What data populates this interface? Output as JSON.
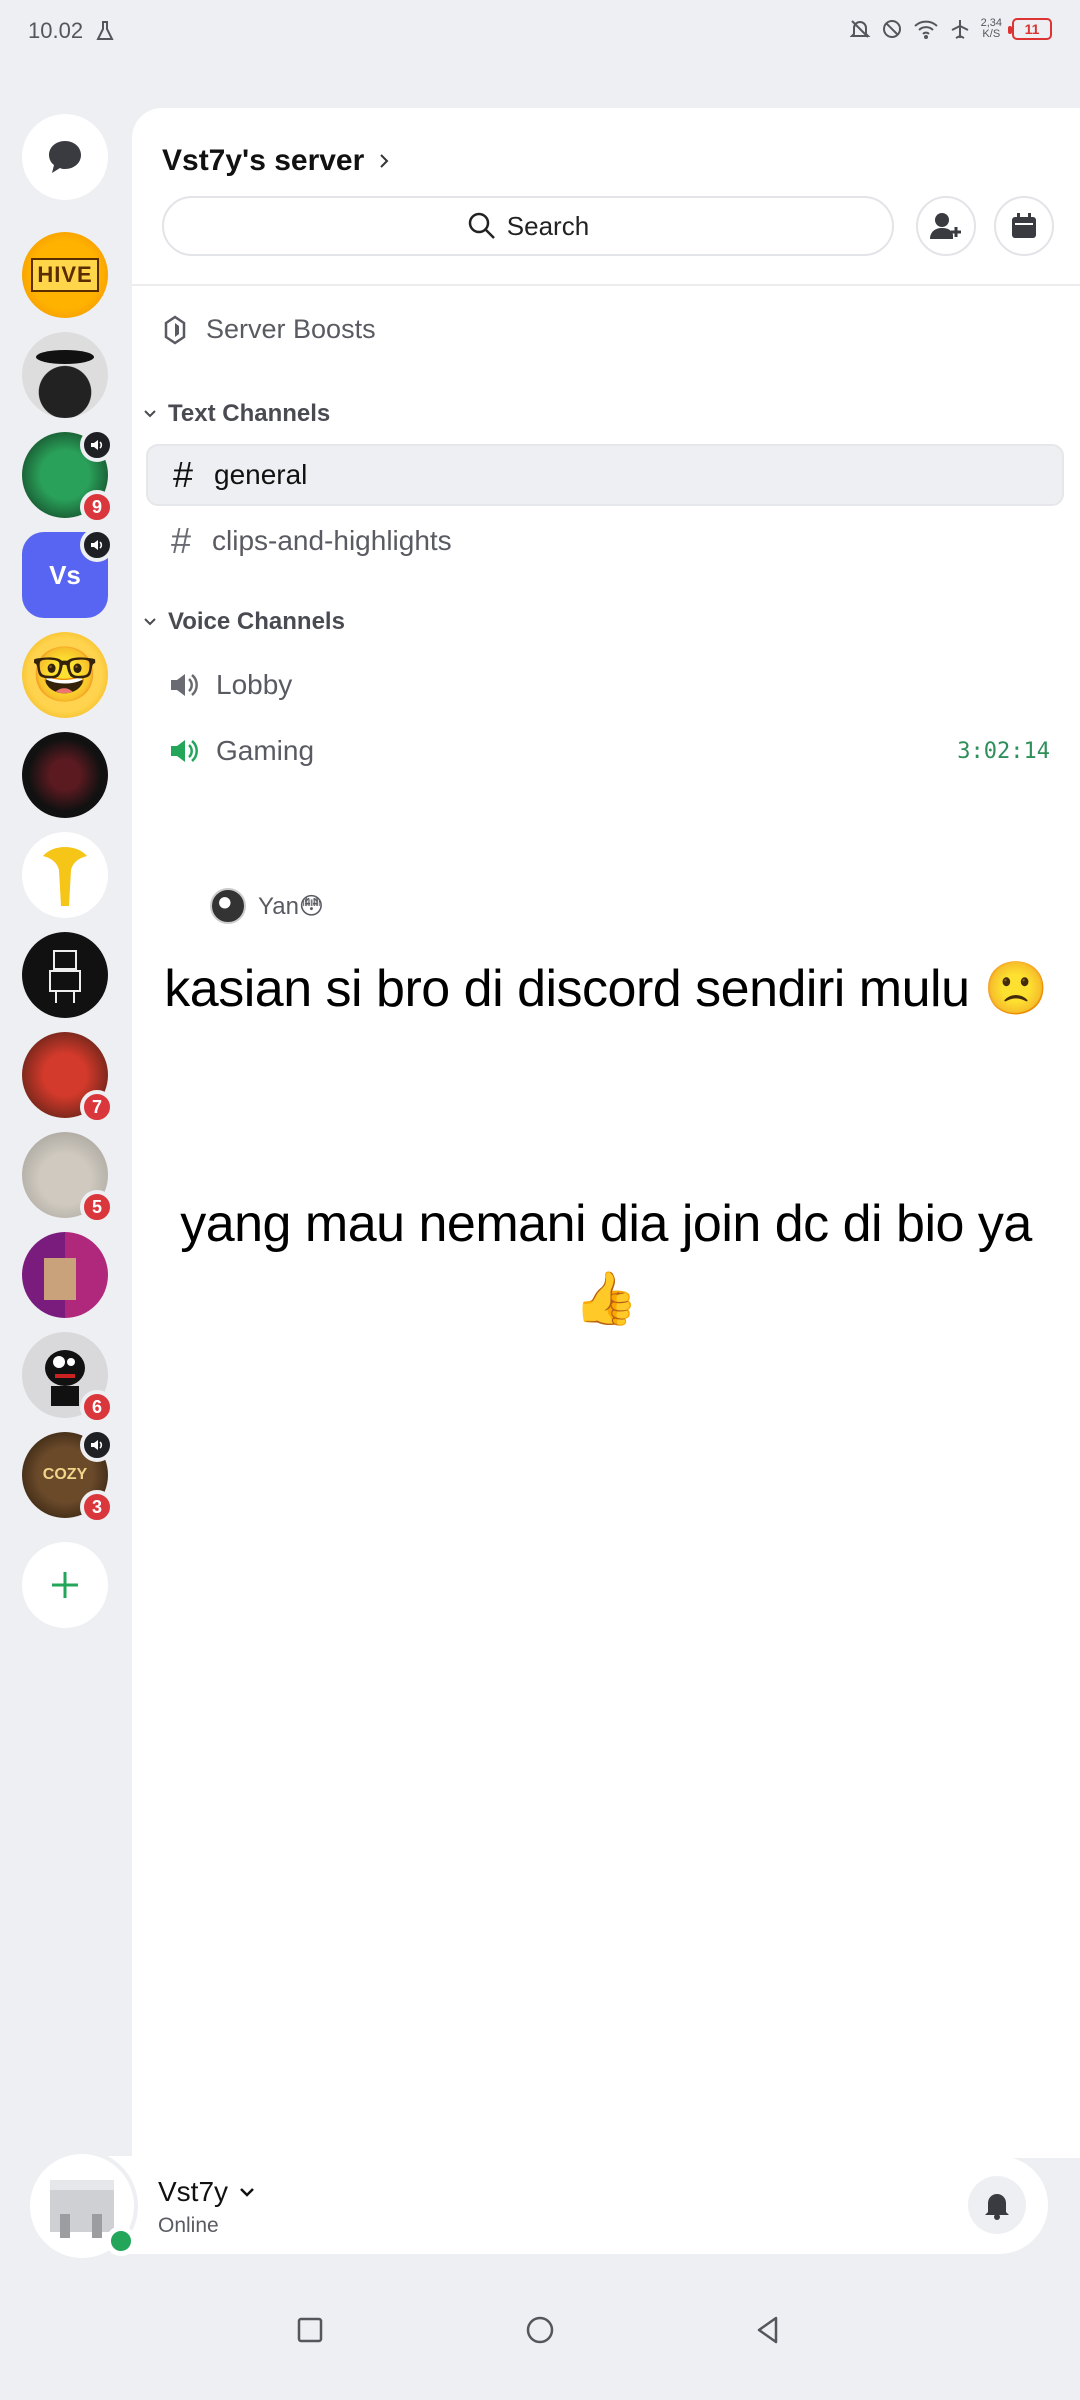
{
  "status": {
    "time": "10.02",
    "speed_top": "2,34",
    "speed_bottom": "K/S",
    "battery": "11"
  },
  "rail": {
    "dm_icon": "chat-bubble-icon",
    "servers": [
      {
        "name": "server-hive",
        "badge": "",
        "voice": false
      },
      {
        "name": "server-dark-hat",
        "badge": "",
        "voice": false
      },
      {
        "name": "server-green-creeper",
        "badge": "9",
        "voice": true
      },
      {
        "name": "server-vs",
        "label": "Vs",
        "badge": "",
        "voice": true
      },
      {
        "name": "server-nerd-emoji",
        "badge": "",
        "voice": false
      },
      {
        "name": "server-dark-crowd",
        "badge": "",
        "voice": false
      },
      {
        "name": "server-yellow-figure",
        "badge": "",
        "voice": false
      },
      {
        "name": "server-sketch-robot",
        "badge": "",
        "voice": false
      },
      {
        "name": "server-red-character",
        "badge": "7",
        "voice": false
      },
      {
        "name": "server-dog",
        "badge": "5",
        "voice": false
      },
      {
        "name": "server-pixel-purple",
        "badge": "",
        "voice": false
      },
      {
        "name": "server-black-creature",
        "badge": "6",
        "voice": false
      },
      {
        "name": "server-cozy",
        "badge": "3",
        "voice": true
      }
    ],
    "add_icon": "plus-icon"
  },
  "server": {
    "title": "Vst7y's server",
    "search_label": "Search",
    "boosts_label": "Server Boosts",
    "text_category": "Text Channels",
    "voice_category": "Voice Channels",
    "text_channels": [
      "general",
      "clips-and-highlights"
    ],
    "voice_channels": [
      "Lobby",
      "Gaming"
    ],
    "gaming_timer": "3:02:14",
    "voice_user": "Yan😳"
  },
  "captions": {
    "line1": "kasian si bro di discord sendiri mulu 🙁",
    "line2": "yang mau nemani dia join dc di bio ya",
    "line3": "👍"
  },
  "user": {
    "name": "Vst7y",
    "status": "Online"
  },
  "colors": {
    "accent_green": "#23a55a",
    "badge_red": "#da373c",
    "blurple": "#5865f2"
  }
}
